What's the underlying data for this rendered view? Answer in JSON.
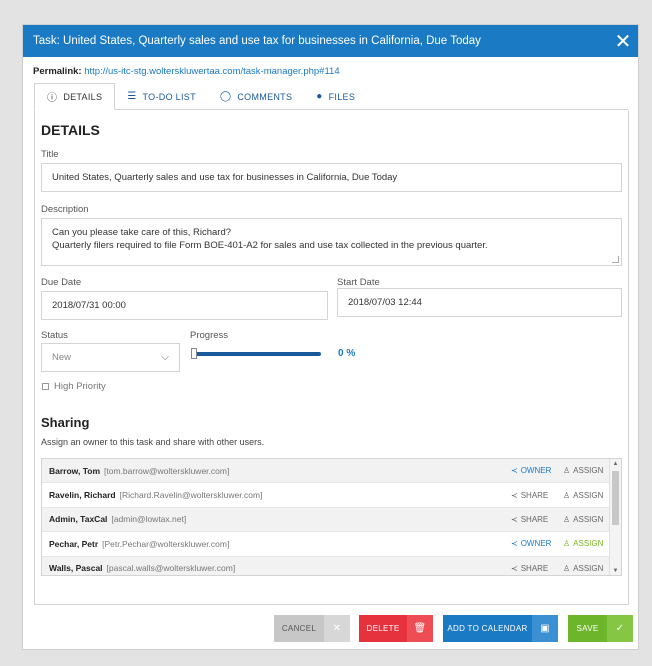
{
  "window": {
    "title": "Task: United States, Quarterly sales and use tax for businesses in California, Due Today",
    "close_glyph": "✕"
  },
  "permalink": {
    "label": "Permalink:",
    "url": "http://us-itc-stg.wolterskluwertaa.com/task-manager.php#114"
  },
  "tabs": [
    {
      "label": "DETAILS",
      "icon": "info-icon",
      "active": true
    },
    {
      "label": "TO-DO LIST",
      "icon": "list-icon",
      "active": false
    },
    {
      "label": "COMMENTS",
      "icon": "comment-icon",
      "active": false
    },
    {
      "label": "FILES",
      "icon": "file-icon",
      "active": false
    }
  ],
  "details": {
    "heading": "DETAILS",
    "title_label": "Title",
    "title_value": "United States, Quarterly sales and use tax for businesses in California, Due Today",
    "description_label": "Description",
    "description_value": "Can you please take care of this, Richard?\nQuarterly filers required to file Form BOE-401-A2 for sales and use tax collected in the previous quarter.",
    "due_date_label": "Due Date",
    "due_date_value": "2018/07/31 00:00",
    "start_date_label": "Start Date",
    "start_date_value": "2018/07/03 12:44",
    "status_label": "Status",
    "status_value": "New",
    "progress_label": "Progress",
    "progress_value": 0,
    "progress_text": "0 %",
    "high_priority_label": "High Priority",
    "high_priority_checked": false
  },
  "sharing": {
    "heading": "Sharing",
    "subtitle": "Assign an owner to this task and share with other users.",
    "owner_label": "OWNER",
    "share_label": "SHARE",
    "assign_label": "ASSIGN",
    "users": [
      {
        "name": "Barrow, Tom",
        "email": "[tom.barrow@wolterskluwer.com]",
        "owner": true,
        "assigned": false
      },
      {
        "name": "Ravelin, Richard",
        "email": "[Richard.Ravelin@wolterskluwer.com]",
        "owner": false,
        "assigned": false
      },
      {
        "name": "Admin, TaxCal",
        "email": "[admin@lowtax.net]",
        "owner": false,
        "assigned": false
      },
      {
        "name": "Pechar, Petr",
        "email": "[Petr.Pechar@wolterskluwer.com]",
        "owner": true,
        "assigned": true
      },
      {
        "name": "Walls, Pascal",
        "email": "[pascal.walls@wolterskluwer.com]",
        "owner": false,
        "assigned": false
      }
    ]
  },
  "footer": {
    "cancel_label": "CANCEL",
    "delete_label": "DELETE",
    "calendar_label": "ADD TO CALENDAR",
    "save_label": "SAVE"
  },
  "colors": {
    "accent": "#1a7ac4",
    "delete": "#e5323c",
    "save": "#6db52a",
    "cancel": "#c7c7c7"
  }
}
